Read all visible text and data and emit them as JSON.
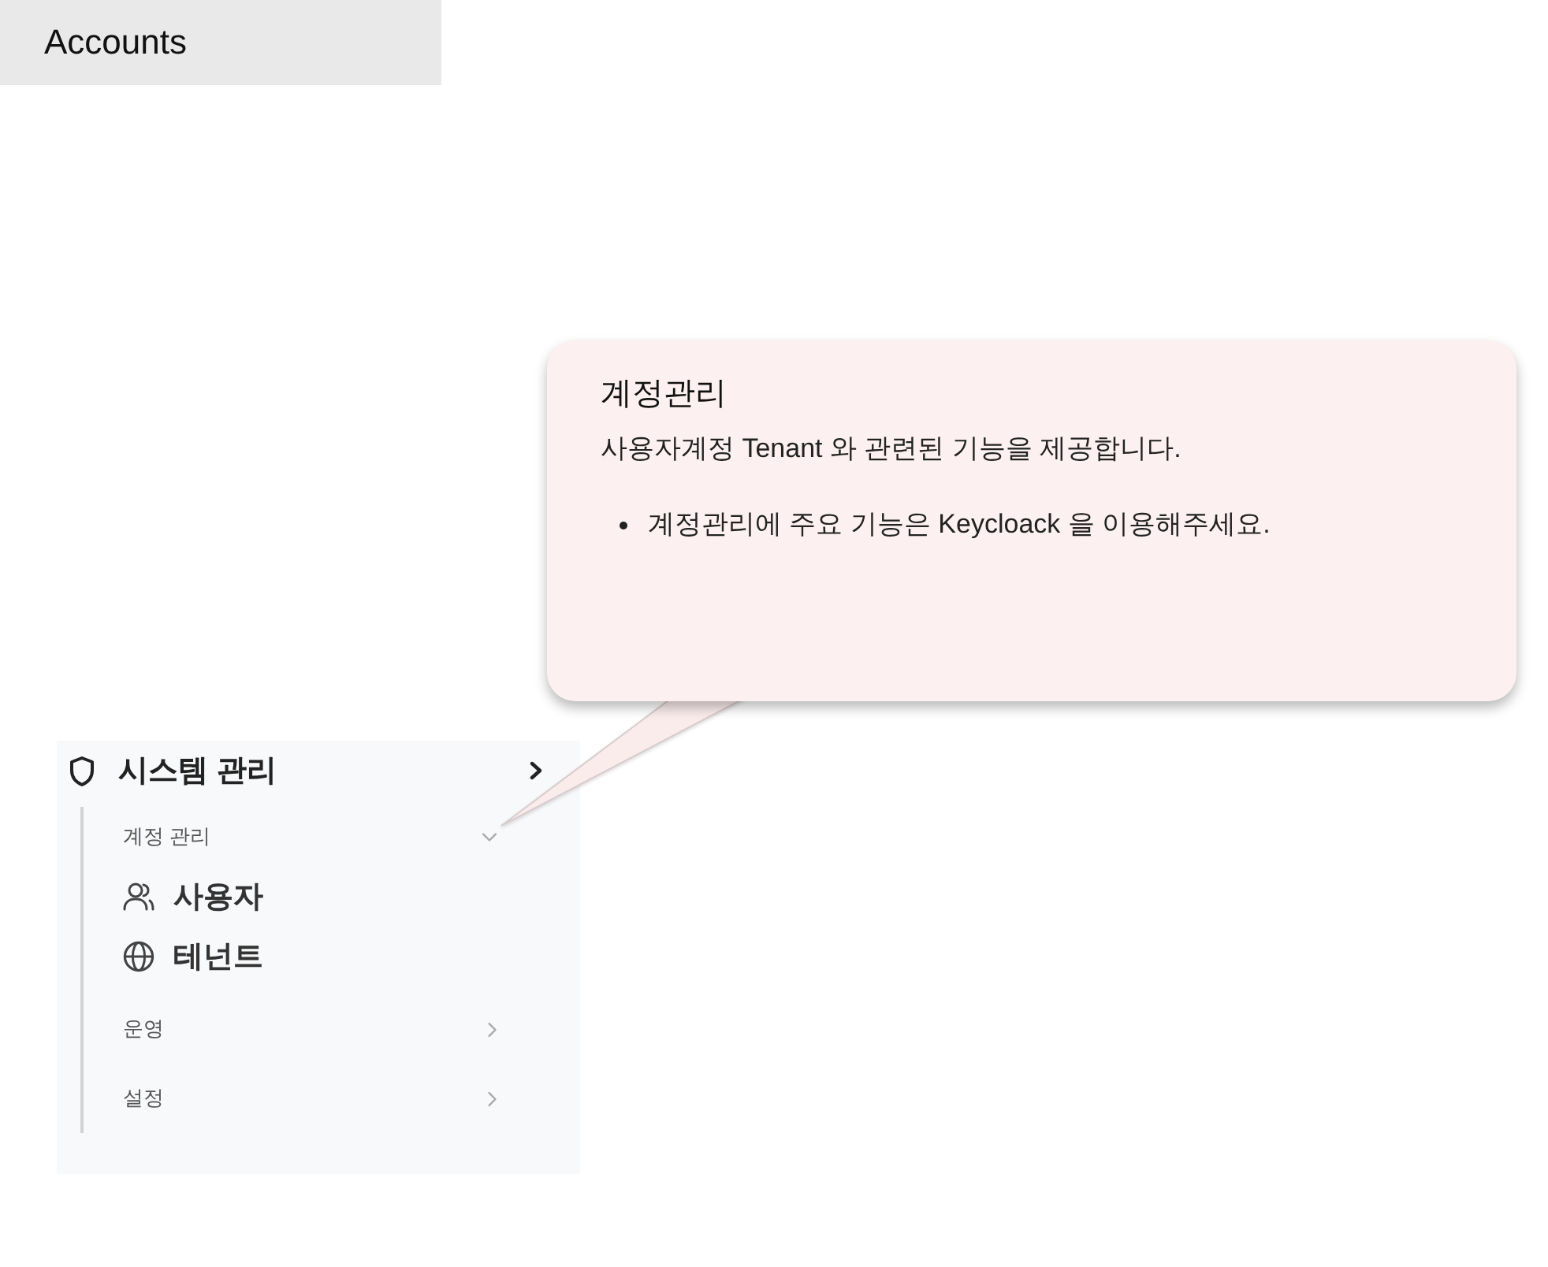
{
  "tab": {
    "label": "Accounts"
  },
  "callout": {
    "title": "계정관리",
    "description": "사용자계정 Tenant 와 관련된 기능을 제공합니다.",
    "bullets": [
      "계정관리에 주요 기능은 Keycloack 을 이용해주세요."
    ]
  },
  "menu": {
    "title": "시스템 관리",
    "groups": [
      {
        "label": "계정 관리",
        "expanded": true,
        "children": [
          {
            "label": "사용자"
          },
          {
            "label": "테넌트"
          }
        ]
      },
      {
        "label": "운영",
        "expanded": false
      },
      {
        "label": "설정",
        "expanded": false
      }
    ]
  }
}
